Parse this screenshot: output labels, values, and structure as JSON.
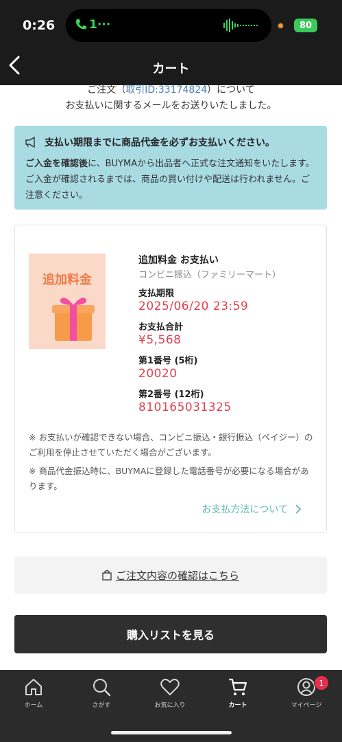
{
  "status": {
    "time": "0:26",
    "call": "1···",
    "battery": "80"
  },
  "nav": {
    "title": "カート"
  },
  "intro": {
    "line1_prefix": "ご注文（",
    "line1_link": "取引ID:33174824",
    "line1_suffix": "）について",
    "line2": "お支払いに関するメールをお送りいたしました。"
  },
  "notice": {
    "heading": "支払い期限までに商品代金を必ずお支払いください。",
    "body_bold": "ご入金を確認後",
    "body_rest": "に、BUYMAから出品者へ正式な注文通知をいたします。ご入金が確認されるまでは、商品の買い付けや配送は行われません。ご注意ください。"
  },
  "payment": {
    "thumb_label": "追加料金",
    "title": "追加料金 お支払い",
    "method": "コンビニ振込（ファミリーマート）",
    "deadline_label": "支払期限",
    "deadline": "2025/06/20 23:59",
    "total_label": "お支払合計",
    "total": "¥5,568",
    "num1_label": "第1番号 (5桁)",
    "num1": "20020",
    "num2_label": "第2番号 (12桁)",
    "num2": "810165031325",
    "note1": "※ お支払いが確認できない場合、コンビニ振込・銀行振込（ペイジー）のご利用を停止させていただく場合がございます。",
    "note2": "※ 商品代金振込時に、BUYMAに登録した電話番号が必要になる場合があります。",
    "method_link": "お支払方法について"
  },
  "confirm_link": "ご注文内容の確認はこちら",
  "buy_button": "購入リストを見る",
  "tabs": [
    {
      "label": "ホーム",
      "icon": "home-icon"
    },
    {
      "label": "さがす",
      "icon": "search-icon"
    },
    {
      "label": "お気に入り",
      "icon": "heart-icon"
    },
    {
      "label": "カート",
      "icon": "cart-icon"
    },
    {
      "label": "マイページ",
      "icon": "user-icon"
    }
  ],
  "mypage_badge": "1",
  "colors": {
    "accent_red": "#e3404e",
    "notice_bg": "#a9dbe3",
    "link_teal": "#5cb8b0",
    "dark": "#2b2b2b"
  }
}
